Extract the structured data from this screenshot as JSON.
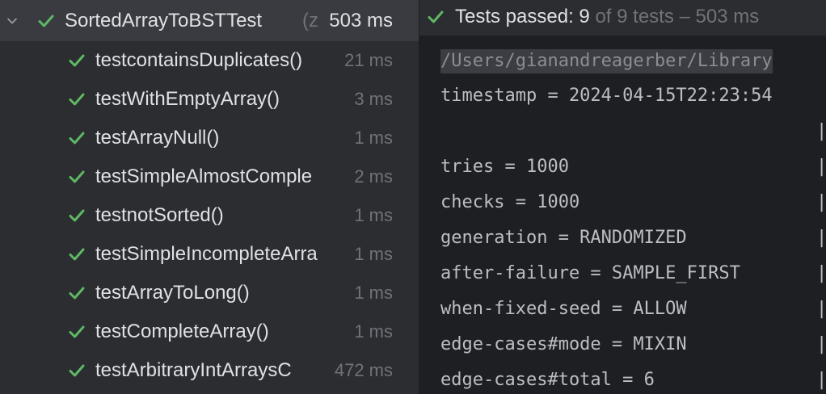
{
  "colors": {
    "success_green": "#5fb865",
    "panel_bg": "#2b2d30",
    "selected_row_bg": "#393b40",
    "console_bg": "#1e1f22"
  },
  "tree": {
    "root": {
      "icon": "chevron-down-icon",
      "status_icon": "check-icon",
      "name": "SortedArrayToBSTTest",
      "suffix": "(z",
      "time": "503 ms"
    },
    "tests": [
      {
        "name": "testcontainsDuplicates()",
        "time": "21 ms"
      },
      {
        "name": "testWithEmptyArray()",
        "time": "3 ms"
      },
      {
        "name": "testArrayNull()",
        "time": "1 ms"
      },
      {
        "name": "testSimpleAlmostComple",
        "time": "2 ms"
      },
      {
        "name": "testnotSorted()",
        "time": "1 ms"
      },
      {
        "name": "testSimpleIncompleteArra",
        "time": "1 ms"
      },
      {
        "name": "testArrayToLong()",
        "time": "1 ms"
      },
      {
        "name": "testCompleteArray()",
        "time": "1 ms"
      },
      {
        "name": "testArbitraryIntArraysC",
        "time": "472 ms"
      }
    ]
  },
  "status": {
    "icon": "check-icon",
    "label": "Tests passed: ",
    "passed": "9",
    "rest": " of 9 tests – 503 ms"
  },
  "console": {
    "path": "/Users/gianandreagerber/Library",
    "lines": [
      "timestamp = 2024-04-15T22:23:54",
      "",
      "tries = 1000",
      "checks = 1000",
      "generation = RANDOMIZED",
      "after-failure = SAMPLE_FIRST",
      "when-fixed-seed = ALLOW",
      "edge-cases#mode = MIXIN",
      "edge-cases#total = 6"
    ],
    "pipe_char": "|"
  }
}
